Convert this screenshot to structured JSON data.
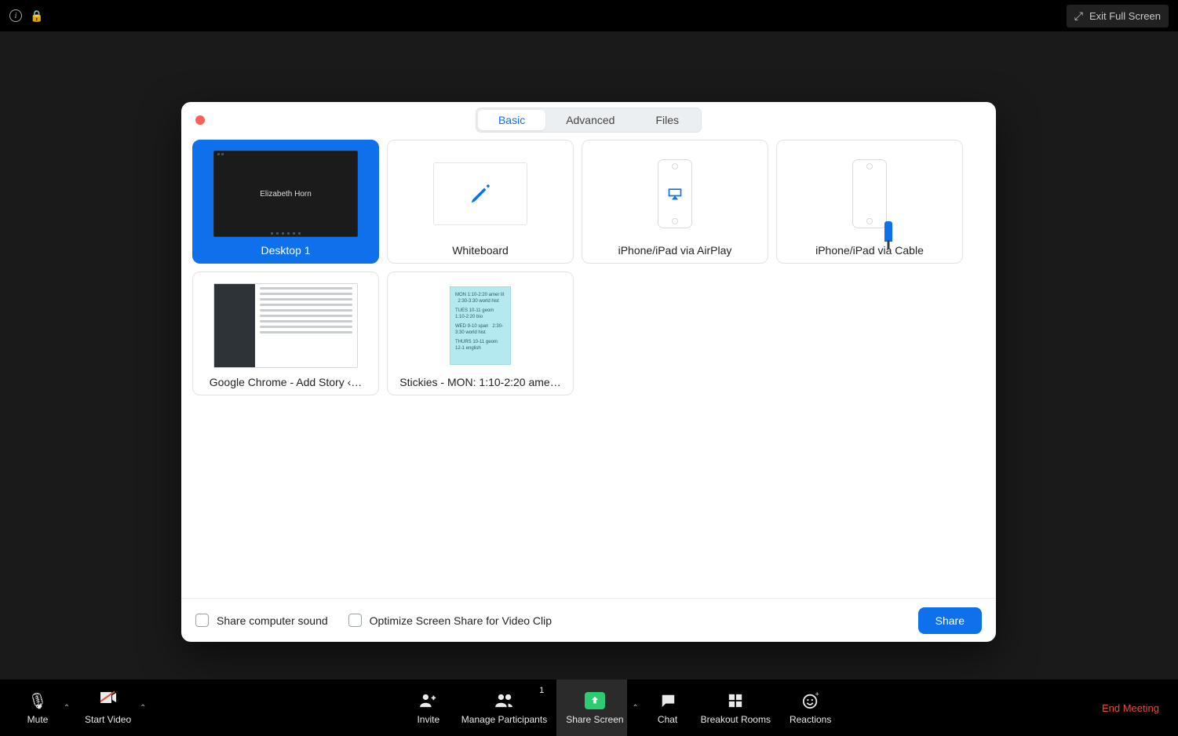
{
  "titlebar": {
    "exit_full_screen": "Exit Full Screen"
  },
  "dialog": {
    "tabs": {
      "basic": "Basic",
      "advanced": "Advanced",
      "files": "Files"
    },
    "sources": {
      "desktop1": {
        "label": "Desktop 1",
        "thumb_text": "Elizabeth Horn"
      },
      "whiteboard": {
        "label": "Whiteboard"
      },
      "airplay": {
        "label": "iPhone/iPad via AirPlay"
      },
      "cable": {
        "label": "iPhone/iPad via Cable"
      },
      "chrome": {
        "label": "Google Chrome - Add Story ‹…"
      },
      "stickies": {
        "label": "Stickies - MON: 1:10-2:20 ame…"
      }
    },
    "checkbox_sound": "Share computer sound",
    "checkbox_video": "Optimize Screen Share for Video Clip",
    "share_button": "Share"
  },
  "toolbar": {
    "mute": "Mute",
    "start_video": "Start Video",
    "invite": "Invite",
    "manage": "Manage Participants",
    "manage_count": "1",
    "share": "Share Screen",
    "chat": "Chat",
    "breakout": "Breakout Rooms",
    "reactions": "Reactions",
    "end": "End Meeting"
  }
}
